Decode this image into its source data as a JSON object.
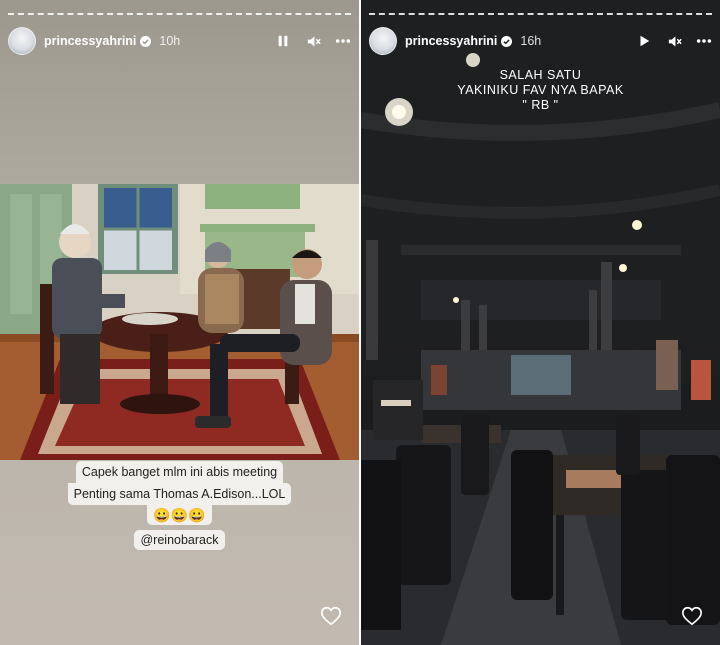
{
  "left_story": {
    "username": "princessyahrini",
    "time": "10h",
    "caption_lines": [
      "Capek banget mlm ini abis meeting",
      "Penting sama Thomas A.Edison...LOL"
    ],
    "caption_emoji": "😀😀😀",
    "mention": "@reinobarack",
    "icons": {
      "avatar": "profile-avatar",
      "verified": "verified-badge-icon",
      "pause": "pause-icon",
      "mute": "mute-icon",
      "more": "more-icon",
      "like": "heart-icon"
    }
  },
  "right_story": {
    "username": "princessyahrini",
    "time": "16h",
    "overlay_lines": [
      "SALAH SATU",
      "YAKINIKU FAV NYA BAPAK",
      "\" RB \""
    ],
    "icons": {
      "avatar": "profile-avatar",
      "verified": "verified-badge-icon",
      "play": "play-icon",
      "mute": "mute-icon",
      "more": "more-icon",
      "like": "heart-icon"
    }
  }
}
